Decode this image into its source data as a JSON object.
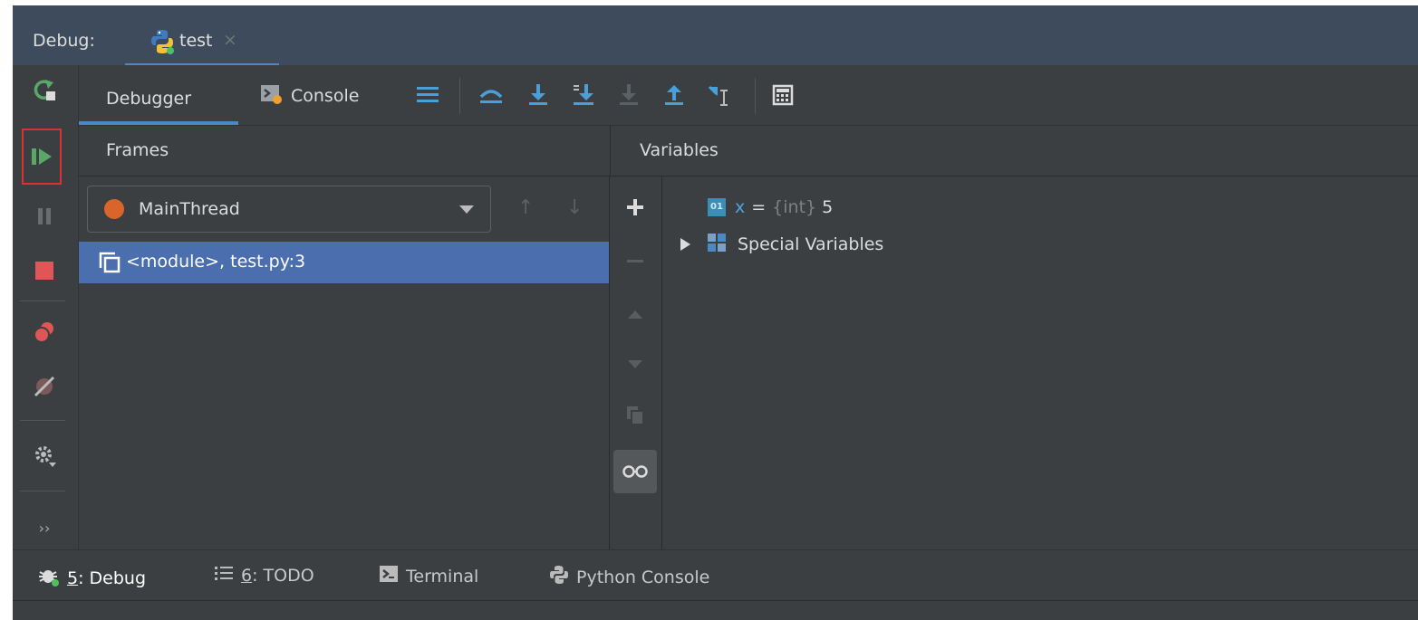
{
  "titlebar": {
    "label": "Debug:",
    "tab_name": "test",
    "tab_close": "×"
  },
  "tabs": {
    "debugger": "Debugger",
    "console": "Console"
  },
  "panels": {
    "frames_header": "Frames",
    "variables_header": "Variables"
  },
  "frames": {
    "thread": "MainThread",
    "thread_color": "#d9652b",
    "up_arrow": "↑",
    "down_arrow": "↓",
    "rows": [
      {
        "label": "<module>, test.py:3"
      }
    ]
  },
  "variables": {
    "x": {
      "name": "x",
      "eq": "=",
      "type": "{int}",
      "value": "5"
    },
    "special": {
      "label": "Special Variables"
    }
  },
  "side": {
    "more": "››"
  },
  "bottom": {
    "debug": {
      "num": "5",
      "rest": ": Debug"
    },
    "todo": {
      "num": "6",
      "rest": ": TODO"
    },
    "terminal": "Terminal",
    "python_console": "Python Console"
  },
  "colors": {
    "accent": "#4a88c7",
    "selection": "#4b6eaf",
    "run_green": "#59a869",
    "stop_red": "#e05555"
  }
}
